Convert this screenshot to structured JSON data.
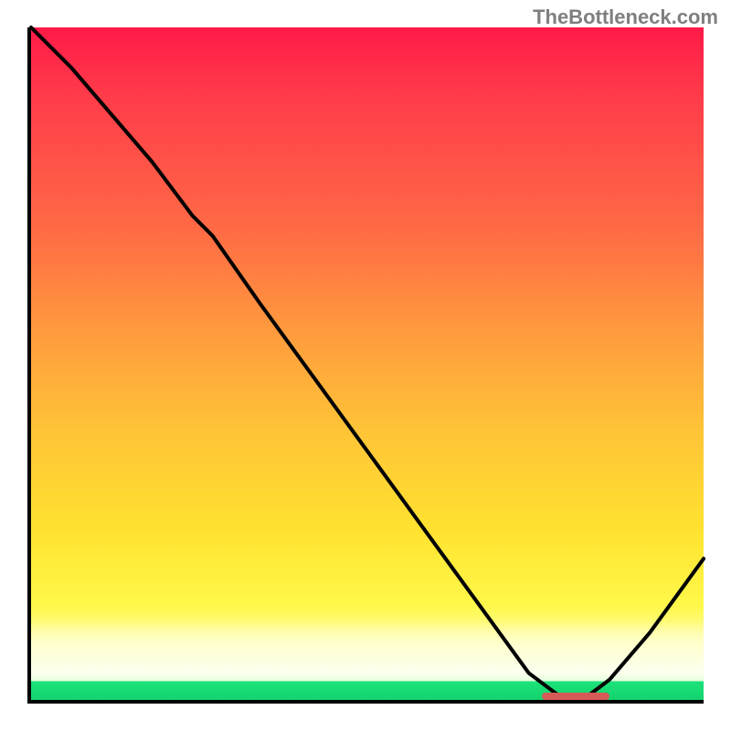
{
  "attribution": "TheBottleneck.com",
  "chart_data": {
    "type": "line",
    "title": "",
    "xlabel": "",
    "ylabel": "",
    "xlim": [
      0,
      100
    ],
    "ylim": [
      0,
      100
    ],
    "series": [
      {
        "name": "bottleneck-curve",
        "x": [
          0,
          6,
          12,
          18,
          24,
          27,
          34,
          42,
          50,
          58,
          66,
          74,
          78,
          80,
          82,
          86,
          92,
          100
        ],
        "y": [
          100,
          94,
          87,
          80,
          72,
          69,
          59,
          48,
          37,
          26,
          15,
          4,
          1,
          0,
          0,
          3,
          10,
          21
        ]
      }
    ],
    "annotations": [
      {
        "name": "minimum-marker",
        "x_start": 76,
        "x_end": 86,
        "y": 0.6
      }
    ],
    "background_gradient": {
      "top": "#ff1a48",
      "mid": "#ffe330",
      "bottom_strip": "#13d36e"
    }
  }
}
